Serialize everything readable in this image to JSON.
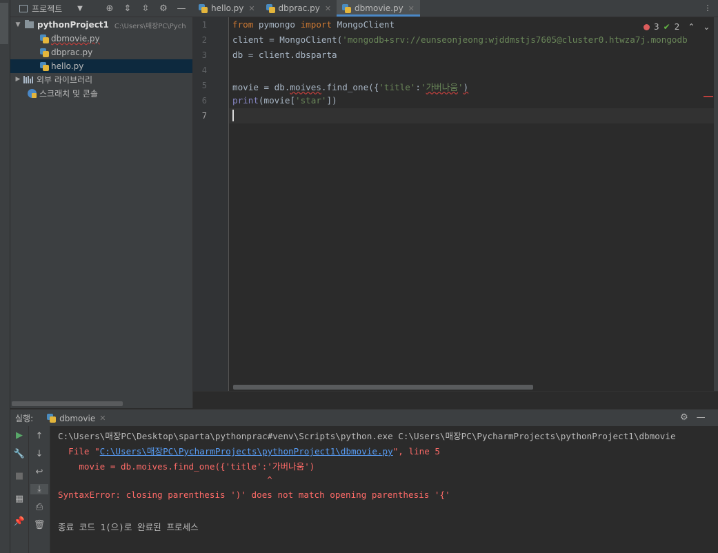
{
  "project_panel": {
    "title": "프로젝트",
    "root_name": "pythonProject1",
    "root_path": "C:\\Users\\매장PC\\Pych",
    "files": [
      "dbmovie.py",
      "dbprac.py",
      "hello.py"
    ],
    "external_libs": "외부 라이브러리",
    "scratches": "스크래치 및 콘솔"
  },
  "editor_tabs": [
    {
      "label": "hello.py"
    },
    {
      "label": "dbprac.py"
    },
    {
      "label": "dbmovie.py",
      "active": true
    }
  ],
  "inspection": {
    "errors": "3",
    "warnings": "2"
  },
  "line_numbers": [
    "1",
    "2",
    "3",
    "4",
    "5",
    "6",
    "7"
  ],
  "code": {
    "l1_kw1": "from",
    "l1_mod": " pymongo ",
    "l1_kw2": "import",
    "l1_name": " MongoClient",
    "l2_a": "client = MongoClient(",
    "l2_str": "'mongodb+srv://eunseonjeong:wjddmstjs7605@cluster0.htwza7j.mongodb",
    "l3": "db = client.dbsparta",
    "l5_a": "movie = db.",
    "l5_moives": "moives",
    "l5_b": ".find_one({",
    "l5_s1": "'title'",
    "l5_colon": ":",
    "l5_s2q1": "'",
    "l5_s2": "가버나움",
    "l5_s2q2": "'",
    "l5_c": ")",
    "l6_print": "print",
    "l6_a": "(movie[",
    "l6_str": "'star'",
    "l6_b": "])"
  },
  "run_panel": {
    "label": "실행:",
    "tab": "dbmovie"
  },
  "console": {
    "line1": "C:\\Users\\매장PC\\Desktop\\sparta\\pythonprac#venv\\Scripts\\python.exe C:\\Users\\매장PC\\PycharmProjects\\pythonProject1\\dbmovie",
    "line2_a": "  File \"",
    "line2_link": "C:\\Users\\매장PC\\PycharmProjects\\pythonProject1\\dbmovie.py",
    "line2_b": "\", line 5",
    "line3": "    movie = db.moives.find_one({'title':'가버나움')",
    "line4": "                                        ^",
    "line5": "SyntaxError: closing parenthesis ')' does not match opening parenthesis '{'",
    "line7": "종료 코드 1(으)로 완료된 프로세스"
  },
  "colors": {
    "background": "#2b2b2b",
    "panel": "#3c3f41",
    "keyword": "#cc7832",
    "string": "#6a8759",
    "error": "#ff6b68",
    "link": "#589df6",
    "selection": "#0d293e"
  }
}
